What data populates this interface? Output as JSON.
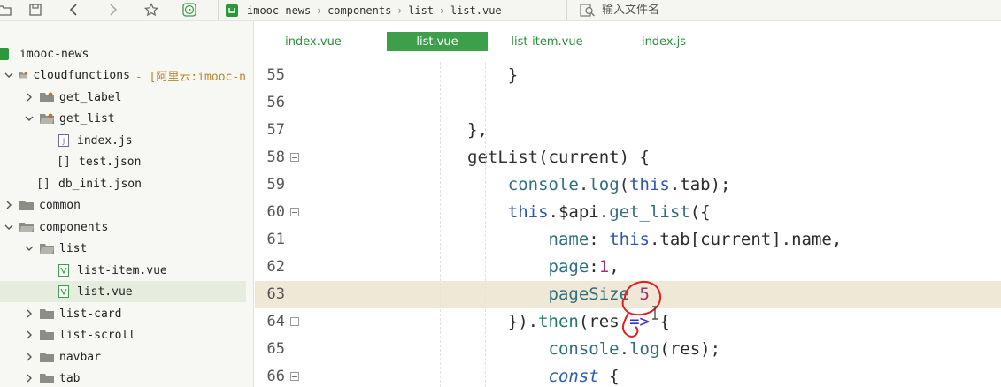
{
  "toolbar": {
    "breadcrumb": [
      "imooc-news",
      "components",
      "list",
      "list.vue"
    ],
    "search_placeholder": "输入文件名"
  },
  "sidebar": {
    "items": [
      {
        "label": "imooc-news",
        "depth": 0,
        "kind": "project"
      },
      {
        "label": "cloudfunctions",
        "suffix": "- [阿里云:imooc-n",
        "depth": 0,
        "kind": "folder-open"
      },
      {
        "label": "get_label",
        "depth": 1,
        "kind": "folder-closed"
      },
      {
        "label": "get_list",
        "depth": 1,
        "kind": "folder-open"
      },
      {
        "label": "index.js",
        "depth": 2,
        "kind": "js-file"
      },
      {
        "label": "test.json",
        "depth": 2,
        "kind": "json-file"
      },
      {
        "label": "db_init.json",
        "depth": 1,
        "kind": "json-file"
      },
      {
        "label": "common",
        "depth": 0,
        "kind": "folder-closed"
      },
      {
        "label": "components",
        "depth": 0,
        "kind": "folder-open"
      },
      {
        "label": "list",
        "depth": 1,
        "kind": "folder-open"
      },
      {
        "label": "list-item.vue",
        "depth": 2,
        "kind": "vue-file"
      },
      {
        "label": "list.vue",
        "depth": 2,
        "kind": "vue-file",
        "selected": true
      },
      {
        "label": "list-card",
        "depth": 1,
        "kind": "folder-closed"
      },
      {
        "label": "list-scroll",
        "depth": 1,
        "kind": "folder-closed"
      },
      {
        "label": "navbar",
        "depth": 1,
        "kind": "folder-closed"
      },
      {
        "label": "tab",
        "depth": 1,
        "kind": "folder-closed"
      }
    ]
  },
  "editor": {
    "tabs": [
      {
        "label": "index.vue"
      },
      {
        "label": "list.vue",
        "active": true
      },
      {
        "label": "list-item.vue"
      },
      {
        "label": "index.js"
      }
    ],
    "lines": [
      {
        "num": "55",
        "fold": false,
        "tokens": [
          {
            "t": "                    }",
            "c": "plain"
          }
        ]
      },
      {
        "num": "56",
        "fold": false,
        "tokens": []
      },
      {
        "num": "57",
        "fold": false,
        "tokens": [
          {
            "t": "                },",
            "c": "plain"
          }
        ]
      },
      {
        "num": "58",
        "fold": true,
        "tokens": [
          {
            "t": "                getList",
            "c": "fn"
          },
          {
            "t": "(current) {",
            "c": "plain"
          }
        ]
      },
      {
        "num": "59",
        "fold": false,
        "tokens": [
          {
            "t": "                    console",
            "c": "prop"
          },
          {
            "t": ".",
            "c": "punc"
          },
          {
            "t": "log",
            "c": "prop"
          },
          {
            "t": "(",
            "c": "punc"
          },
          {
            "t": "this",
            "c": "this"
          },
          {
            "t": ".tab);",
            "c": "plain"
          }
        ]
      },
      {
        "num": "60",
        "fold": true,
        "tokens": [
          {
            "t": "                    this",
            "c": "this"
          },
          {
            "t": ".$api.",
            "c": "plain"
          },
          {
            "t": "get_list",
            "c": "prop"
          },
          {
            "t": "({",
            "c": "plain"
          }
        ]
      },
      {
        "num": "61",
        "fold": false,
        "tokens": [
          {
            "t": "                        name",
            "c": "prop"
          },
          {
            "t": ": ",
            "c": "plain"
          },
          {
            "t": "this",
            "c": "this"
          },
          {
            "t": ".tab[current].name,",
            "c": "plain"
          }
        ]
      },
      {
        "num": "62",
        "fold": false,
        "tokens": [
          {
            "t": "                        page",
            "c": "prop"
          },
          {
            "t": ":",
            "c": "plain"
          },
          {
            "t": "1",
            "c": "num"
          },
          {
            "t": ",",
            "c": "plain"
          }
        ]
      },
      {
        "num": "63",
        "fold": false,
        "current": true,
        "tokens": [
          {
            "t": "                        pageSize ",
            "c": "prop"
          },
          {
            "t": "5",
            "c": "num"
          }
        ]
      },
      {
        "num": "64",
        "fold": true,
        "tokens": [
          {
            "t": "                    }).",
            "c": "plain"
          },
          {
            "t": "then",
            "c": "then"
          },
          {
            "t": "(res ",
            "c": "plain"
          },
          {
            "t": "=>",
            "c": "arrow"
          },
          {
            "t": " {",
            "c": "plain"
          }
        ]
      },
      {
        "num": "65",
        "fold": false,
        "tokens": [
          {
            "t": "                        console",
            "c": "prop"
          },
          {
            "t": ".",
            "c": "punc"
          },
          {
            "t": "log",
            "c": "prop"
          },
          {
            "t": "(res);",
            "c": "plain"
          }
        ]
      },
      {
        "num": "66",
        "fold": true,
        "tokens": [
          {
            "t": "                        const",
            "c": "kw"
          },
          {
            "t": " {",
            "c": "plain"
          }
        ]
      }
    ]
  },
  "colors": {
    "accent_green": "#3d9f4a",
    "annotation_red": "#e02020",
    "current_line": "#efe8d6"
  }
}
